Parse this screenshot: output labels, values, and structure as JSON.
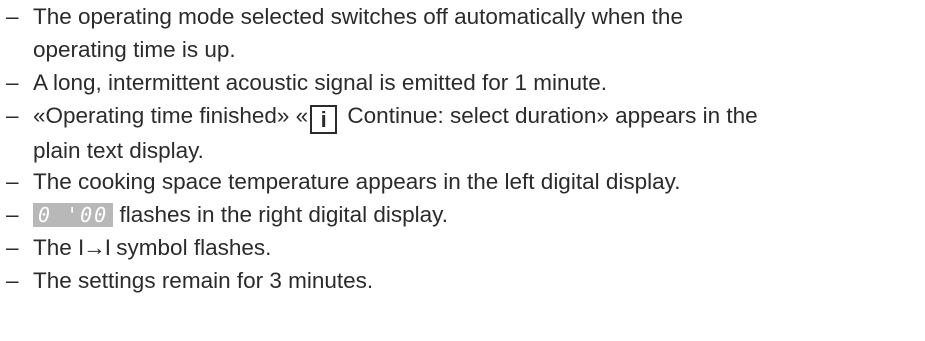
{
  "list": {
    "dash": "–",
    "item1_line1": "The operating mode selected switches off automatically when the",
    "item1_line2": "operating time is up.",
    "item2": "A long, intermittent acoustic signal is emitted for 1 minute.",
    "item3_pre": "«Operating time finished» «",
    "item3_icon": "i",
    "item3_post": " Continue: select duration» appears in the",
    "item3_line2": "plain text display.",
    "item4": "The cooking space temperature appears in the left digital display.",
    "item5_display": "0 '00",
    "item5_post": " flashes in the right digital display.",
    "item6_pre": "The ",
    "item6_symbol": "I→I",
    "item6_post": " symbol flashes.",
    "item7": "The settings remain for 3 minutes."
  }
}
